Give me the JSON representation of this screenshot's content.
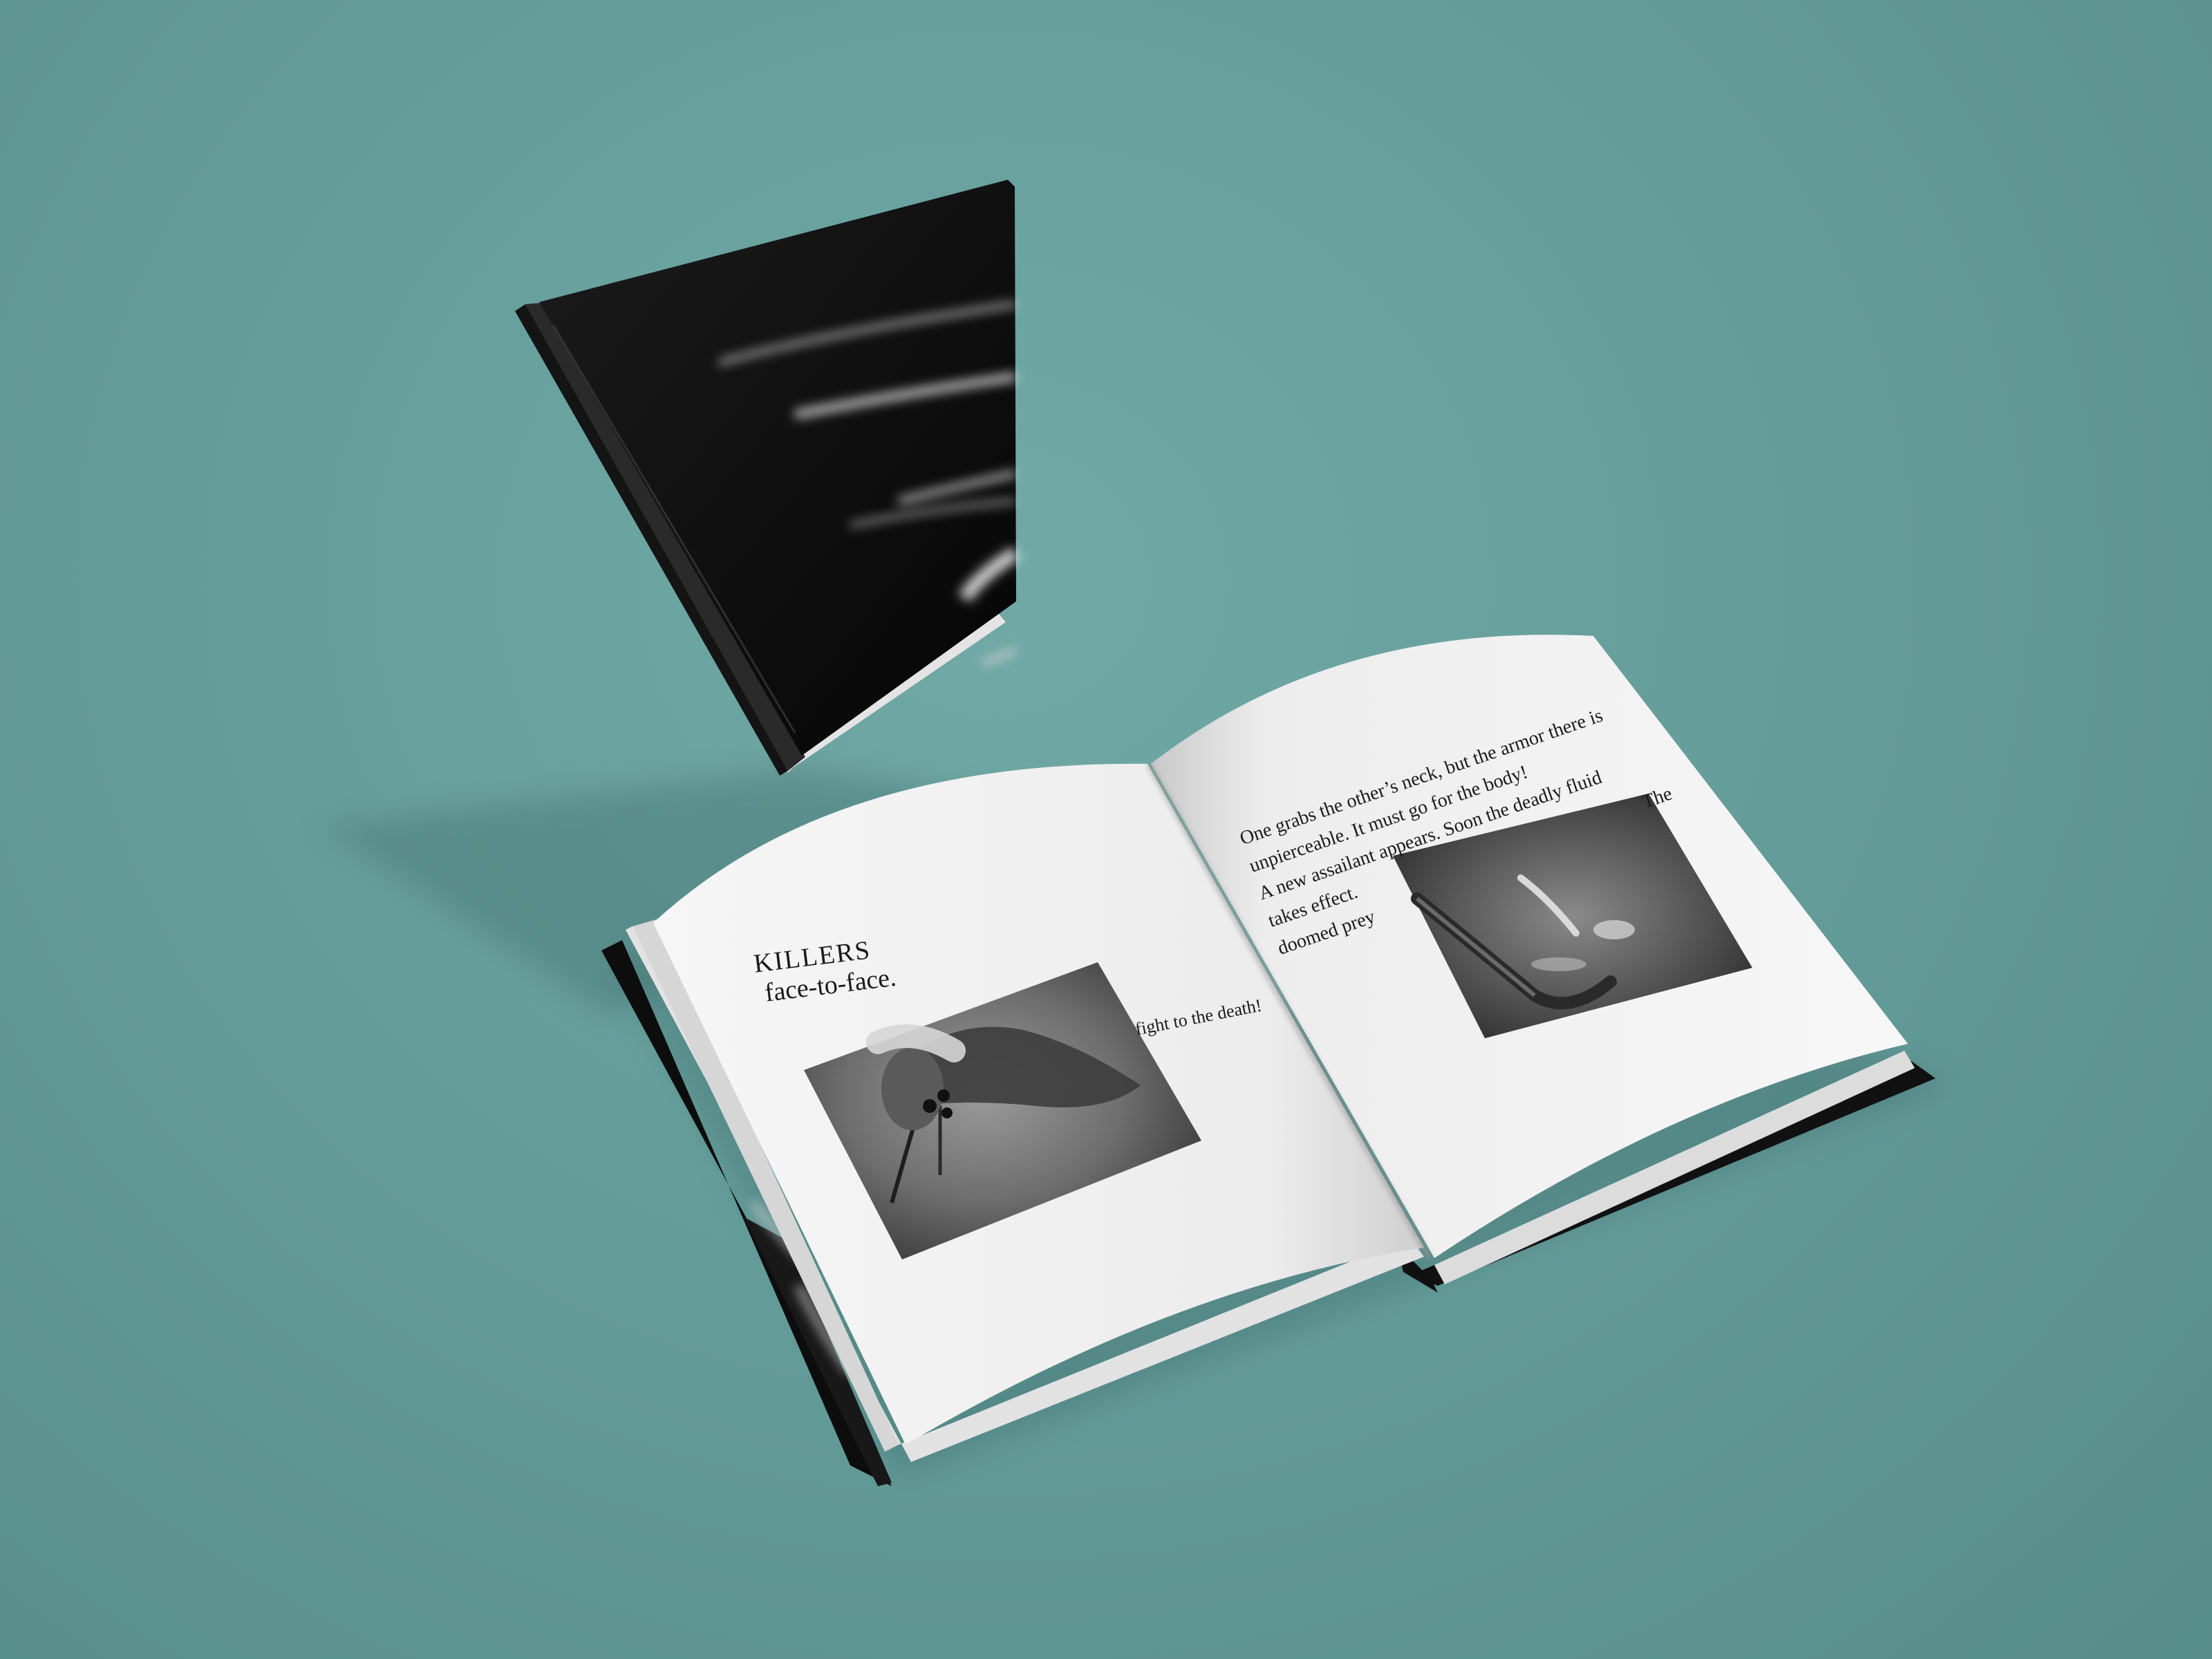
{
  "colors": {
    "background": "#659d9b",
    "cover": "#111111",
    "paper": "#f1f1f1",
    "ink": "#1a1a1a"
  },
  "closed_book": {
    "cover_design": "black glossy cover with white light streaks"
  },
  "open_book": {
    "left_page": {
      "title": "KILLERS",
      "subtitle": "face-to-face.",
      "aside": "fight to the death!",
      "photo": "grayscale close-up of an aquatic insect larva gripping prey"
    },
    "right_page": {
      "lines": [
        "One grabs the other’s neck, but the armor there is",
        "unpierceable. It must go for the body!",
        "A new assailant appears. Soon the deadly fluid",
        "takes effect.",
        "doomed prey"
      ],
      "trailing_word": "The",
      "photo": "grayscale photo of a slender water insect attacking a larva"
    }
  }
}
